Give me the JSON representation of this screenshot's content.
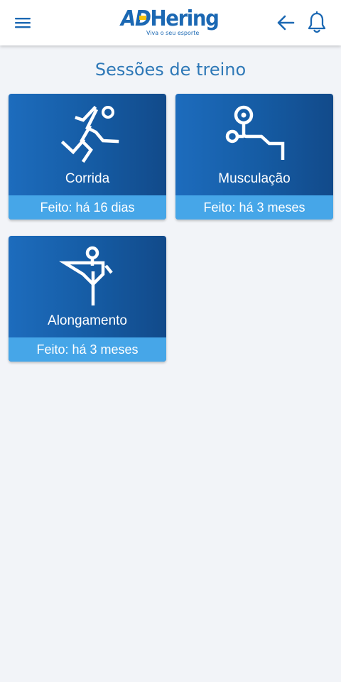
{
  "header": {
    "logo_text_ad": "AD",
    "logo_text_rest": "Hering",
    "logo_tagline": "Viva o seu esporte",
    "icons": {
      "menu": "hamburger-menu-icon",
      "back": "arrow-left-icon",
      "notifications": "bell-icon"
    },
    "colors": {
      "brand_blue": "#1b68b3",
      "brand_yellow": "#f4c20d"
    }
  },
  "page": {
    "title": "Sessões de treino"
  },
  "sessions": [
    {
      "label": "Corrida",
      "status": "Feito: há 16 dias",
      "icon": "runner-icon"
    },
    {
      "label": "Musculação",
      "status": "Feito: há 3 meses",
      "icon": "weight-bench-icon"
    },
    {
      "label": "Alongamento",
      "status": "Feito: há 3 meses",
      "icon": "stretching-icon"
    }
  ],
  "colors": {
    "card_gradient_start": "#1d6cbd",
    "card_gradient_end": "#124a8a",
    "card_footer": "#46a6e8",
    "title_color": "#2e78b7",
    "background": "#f2f4f8"
  }
}
